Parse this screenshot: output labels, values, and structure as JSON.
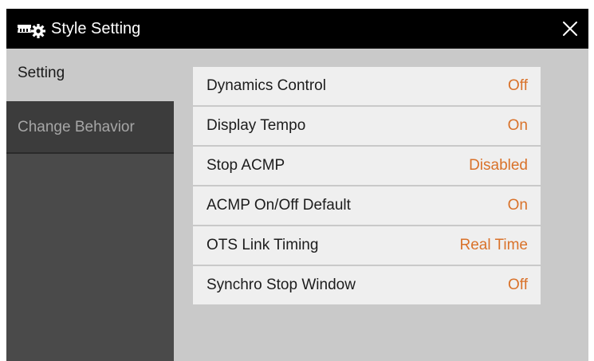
{
  "window": {
    "title": "Style Setting",
    "title_icon": "style-setting-icon",
    "close_icon": "close-icon"
  },
  "tabs": [
    {
      "label": "Setting",
      "active": true
    },
    {
      "label": "Change Behavior",
      "active": false
    }
  ],
  "settings": [
    {
      "label": "Dynamics Control",
      "value": "Off"
    },
    {
      "label": "Display Tempo",
      "value": "On"
    },
    {
      "label": "Stop ACMP",
      "value": "Disabled"
    },
    {
      "label": "ACMP On/Off Default",
      "value": "On"
    },
    {
      "label": "OTS Link Timing",
      "value": "Real Time"
    },
    {
      "label": "Synchro Stop Window",
      "value": "Off"
    }
  ],
  "colors": {
    "value_accent": "#d9722a",
    "titlebar": "#000000",
    "panel": "#c9c9c9",
    "sidebar": "#4a4a4a",
    "row": "#efefef"
  }
}
